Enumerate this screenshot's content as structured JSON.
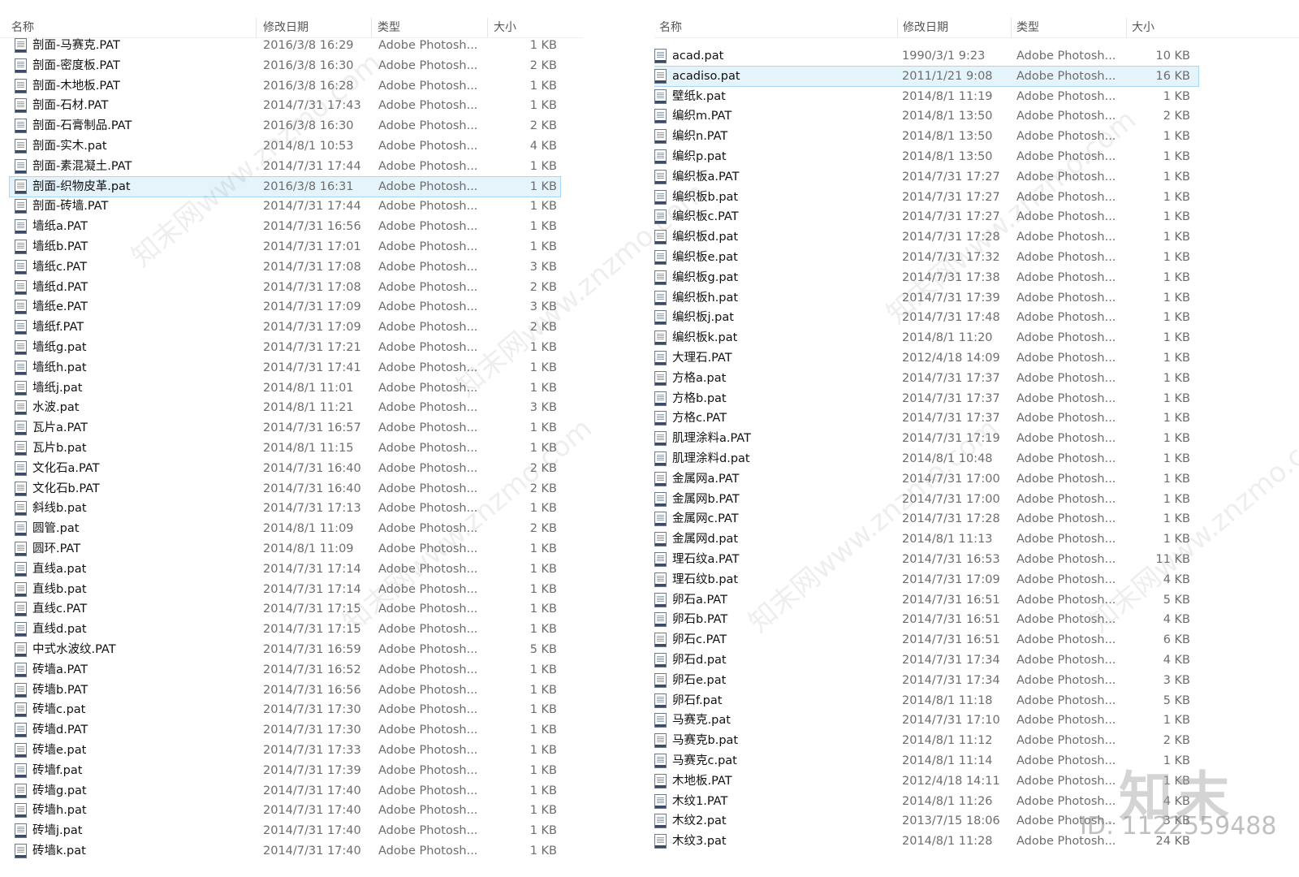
{
  "columns": {
    "name": "名称",
    "date": "修改日期",
    "type": "类型",
    "size": "大小"
  },
  "left_rows": [
    {
      "name": "剖面-马赛克.PAT",
      "date": "2016/3/8 16:29",
      "type": "Adobe Photosh...",
      "size": "1 KB"
    },
    {
      "name": "剖面-密度板.PAT",
      "date": "2016/3/8 16:30",
      "type": "Adobe Photosh...",
      "size": "2 KB"
    },
    {
      "name": "剖面-木地板.PAT",
      "date": "2016/3/8 16:28",
      "type": "Adobe Photosh...",
      "size": "1 KB"
    },
    {
      "name": "剖面-石材.PAT",
      "date": "2014/7/31 17:43",
      "type": "Adobe Photosh...",
      "size": "1 KB"
    },
    {
      "name": "剖面-石膏制品.PAT",
      "date": "2016/3/8 16:30",
      "type": "Adobe Photosh...",
      "size": "2 KB"
    },
    {
      "name": "剖面-实木.pat",
      "date": "2014/8/1 10:53",
      "type": "Adobe Photosh...",
      "size": "4 KB"
    },
    {
      "name": "剖面-素混凝土.PAT",
      "date": "2014/7/31 17:44",
      "type": "Adobe Photosh...",
      "size": "1 KB"
    },
    {
      "name": "剖面-织物皮革.pat",
      "date": "2016/3/8 16:31",
      "type": "Adobe Photosh...",
      "size": "1 KB",
      "selected": true
    },
    {
      "name": "剖面-砖墙.PAT",
      "date": "2014/7/31 17:44",
      "type": "Adobe Photosh...",
      "size": "1 KB"
    },
    {
      "name": "墙纸a.PAT",
      "date": "2014/7/31 16:56",
      "type": "Adobe Photosh...",
      "size": "1 KB"
    },
    {
      "name": "墙纸b.PAT",
      "date": "2014/7/31 17:01",
      "type": "Adobe Photosh...",
      "size": "1 KB"
    },
    {
      "name": "墙纸c.PAT",
      "date": "2014/7/31 17:08",
      "type": "Adobe Photosh...",
      "size": "3 KB"
    },
    {
      "name": "墙纸d.PAT",
      "date": "2014/7/31 17:08",
      "type": "Adobe Photosh...",
      "size": "2 KB"
    },
    {
      "name": "墙纸e.PAT",
      "date": "2014/7/31 17:09",
      "type": "Adobe Photosh...",
      "size": "3 KB"
    },
    {
      "name": "墙纸f.PAT",
      "date": "2014/7/31 17:09",
      "type": "Adobe Photosh...",
      "size": "2 KB"
    },
    {
      "name": "墙纸g.pat",
      "date": "2014/7/31 17:21",
      "type": "Adobe Photosh...",
      "size": "1 KB"
    },
    {
      "name": "墙纸h.pat",
      "date": "2014/7/31 17:41",
      "type": "Adobe Photosh...",
      "size": "1 KB"
    },
    {
      "name": "墙纸j.pat",
      "date": "2014/8/1 11:01",
      "type": "Adobe Photosh...",
      "size": "1 KB"
    },
    {
      "name": "水波.pat",
      "date": "2014/8/1 11:21",
      "type": "Adobe Photosh...",
      "size": "3 KB"
    },
    {
      "name": "瓦片a.PAT",
      "date": "2014/7/31 16:57",
      "type": "Adobe Photosh...",
      "size": "1 KB"
    },
    {
      "name": "瓦片b.pat",
      "date": "2014/8/1 11:15",
      "type": "Adobe Photosh...",
      "size": "1 KB"
    },
    {
      "name": "文化石a.PAT",
      "date": "2014/7/31 16:40",
      "type": "Adobe Photosh...",
      "size": "2 KB"
    },
    {
      "name": "文化石b.PAT",
      "date": "2014/7/31 16:40",
      "type": "Adobe Photosh...",
      "size": "2 KB"
    },
    {
      "name": "斜线b.pat",
      "date": "2014/7/31 17:13",
      "type": "Adobe Photosh...",
      "size": "1 KB"
    },
    {
      "name": "圆管.pat",
      "date": "2014/8/1 11:09",
      "type": "Adobe Photosh...",
      "size": "2 KB"
    },
    {
      "name": "圆环.PAT",
      "date": "2014/8/1 11:09",
      "type": "Adobe Photosh...",
      "size": "1 KB"
    },
    {
      "name": "直线a.pat",
      "date": "2014/7/31 17:14",
      "type": "Adobe Photosh...",
      "size": "1 KB"
    },
    {
      "name": "直线b.pat",
      "date": "2014/7/31 17:14",
      "type": "Adobe Photosh...",
      "size": "1 KB"
    },
    {
      "name": "直线c.PAT",
      "date": "2014/7/31 17:15",
      "type": "Adobe Photosh...",
      "size": "1 KB"
    },
    {
      "name": "直线d.pat",
      "date": "2014/7/31 17:15",
      "type": "Adobe Photosh...",
      "size": "1 KB"
    },
    {
      "name": "中式水波纹.PAT",
      "date": "2014/7/31 16:59",
      "type": "Adobe Photosh...",
      "size": "5 KB"
    },
    {
      "name": "砖墙a.PAT",
      "date": "2014/7/31 16:52",
      "type": "Adobe Photosh...",
      "size": "1 KB"
    },
    {
      "name": "砖墙b.PAT",
      "date": "2014/7/31 16:56",
      "type": "Adobe Photosh...",
      "size": "1 KB"
    },
    {
      "name": "砖墙c.pat",
      "date": "2014/7/31 17:30",
      "type": "Adobe Photosh...",
      "size": "1 KB"
    },
    {
      "name": "砖墙d.PAT",
      "date": "2014/7/31 17:30",
      "type": "Adobe Photosh...",
      "size": "1 KB"
    },
    {
      "name": "砖墙e.pat",
      "date": "2014/7/31 17:33",
      "type": "Adobe Photosh...",
      "size": "1 KB"
    },
    {
      "name": "砖墙f.pat",
      "date": "2014/7/31 17:39",
      "type": "Adobe Photosh...",
      "size": "1 KB"
    },
    {
      "name": "砖墙g.pat",
      "date": "2014/7/31 17:40",
      "type": "Adobe Photosh...",
      "size": "1 KB"
    },
    {
      "name": "砖墙h.pat",
      "date": "2014/7/31 17:40",
      "type": "Adobe Photosh...",
      "size": "1 KB"
    },
    {
      "name": "砖墙j.pat",
      "date": "2014/7/31 17:40",
      "type": "Adobe Photosh...",
      "size": "1 KB"
    },
    {
      "name": "砖墙k.pat",
      "date": "2014/7/31 17:40",
      "type": "Adobe Photosh...",
      "size": "1 KB"
    }
  ],
  "right_rows": [
    {
      "name": "acad.pat",
      "date": "1990/3/1 9:23",
      "type": "Adobe Photosh...",
      "size": "10 KB"
    },
    {
      "name": "acadiso.pat",
      "date": "2011/1/21 9:08",
      "type": "Adobe Photosh...",
      "size": "16 KB",
      "selected": true
    },
    {
      "name": "壁纸k.pat",
      "date": "2014/8/1 11:19",
      "type": "Adobe Photosh...",
      "size": "1 KB"
    },
    {
      "name": "编织m.PAT",
      "date": "2014/8/1 13:50",
      "type": "Adobe Photosh...",
      "size": "2 KB"
    },
    {
      "name": "编织n.PAT",
      "date": "2014/8/1 13:50",
      "type": "Adobe Photosh...",
      "size": "1 KB"
    },
    {
      "name": "编织p.pat",
      "date": "2014/8/1 13:50",
      "type": "Adobe Photosh...",
      "size": "1 KB"
    },
    {
      "name": "编织板a.PAT",
      "date": "2014/7/31 17:27",
      "type": "Adobe Photosh...",
      "size": "1 KB"
    },
    {
      "name": "编织板b.pat",
      "date": "2014/7/31 17:27",
      "type": "Adobe Photosh...",
      "size": "1 KB"
    },
    {
      "name": "编织板c.PAT",
      "date": "2014/7/31 17:27",
      "type": "Adobe Photosh...",
      "size": "1 KB"
    },
    {
      "name": "编织板d.pat",
      "date": "2014/7/31 17:28",
      "type": "Adobe Photosh...",
      "size": "1 KB"
    },
    {
      "name": "编织板e.pat",
      "date": "2014/7/31 17:32",
      "type": "Adobe Photosh...",
      "size": "1 KB"
    },
    {
      "name": "编织板g.pat",
      "date": "2014/7/31 17:38",
      "type": "Adobe Photosh...",
      "size": "1 KB"
    },
    {
      "name": "编织板h.pat",
      "date": "2014/7/31 17:39",
      "type": "Adobe Photosh...",
      "size": "1 KB"
    },
    {
      "name": "编织板j.pat",
      "date": "2014/7/31 17:48",
      "type": "Adobe Photosh...",
      "size": "1 KB"
    },
    {
      "name": "编织板k.pat",
      "date": "2014/8/1 11:20",
      "type": "Adobe Photosh...",
      "size": "1 KB"
    },
    {
      "name": "大理石.PAT",
      "date": "2012/4/18 14:09",
      "type": "Adobe Photosh...",
      "size": "1 KB"
    },
    {
      "name": "方格a.pat",
      "date": "2014/7/31 17:37",
      "type": "Adobe Photosh...",
      "size": "1 KB"
    },
    {
      "name": "方格b.pat",
      "date": "2014/7/31 17:37",
      "type": "Adobe Photosh...",
      "size": "1 KB"
    },
    {
      "name": "方格c.PAT",
      "date": "2014/7/31 17:37",
      "type": "Adobe Photosh...",
      "size": "1 KB"
    },
    {
      "name": "肌理涂料a.PAT",
      "date": "2014/7/31 17:19",
      "type": "Adobe Photosh...",
      "size": "1 KB"
    },
    {
      "name": "肌理涂料d.pat",
      "date": "2014/8/1 10:48",
      "type": "Adobe Photosh...",
      "size": "1 KB"
    },
    {
      "name": "金属网a.PAT",
      "date": "2014/7/31 17:00",
      "type": "Adobe Photosh...",
      "size": "1 KB"
    },
    {
      "name": "金属网b.PAT",
      "date": "2014/7/31 17:00",
      "type": "Adobe Photosh...",
      "size": "1 KB"
    },
    {
      "name": "金属网c.PAT",
      "date": "2014/7/31 17:28",
      "type": "Adobe Photosh...",
      "size": "1 KB"
    },
    {
      "name": "金属网d.pat",
      "date": "2014/8/1 11:13",
      "type": "Adobe Photosh...",
      "size": "1 KB"
    },
    {
      "name": "理石纹a.PAT",
      "date": "2014/7/31 16:53",
      "type": "Adobe Photosh...",
      "size": "11 KB"
    },
    {
      "name": "理石纹b.pat",
      "date": "2014/7/31 17:09",
      "type": "Adobe Photosh...",
      "size": "4 KB"
    },
    {
      "name": "卵石a.PAT",
      "date": "2014/7/31 16:51",
      "type": "Adobe Photosh...",
      "size": "5 KB"
    },
    {
      "name": "卵石b.PAT",
      "date": "2014/7/31 16:51",
      "type": "Adobe Photosh...",
      "size": "4 KB"
    },
    {
      "name": "卵石c.PAT",
      "date": "2014/7/31 16:51",
      "type": "Adobe Photosh...",
      "size": "6 KB"
    },
    {
      "name": "卵石d.pat",
      "date": "2014/7/31 17:34",
      "type": "Adobe Photosh...",
      "size": "4 KB"
    },
    {
      "name": "卵石e.pat",
      "date": "2014/7/31 17:34",
      "type": "Adobe Photosh...",
      "size": "3 KB"
    },
    {
      "name": "卵石f.pat",
      "date": "2014/8/1 11:18",
      "type": "Adobe Photosh...",
      "size": "5 KB"
    },
    {
      "name": "马赛克.pat",
      "date": "2014/7/31 17:10",
      "type": "Adobe Photosh...",
      "size": "1 KB"
    },
    {
      "name": "马赛克b.pat",
      "date": "2014/8/1 11:12",
      "type": "Adobe Photosh...",
      "size": "2 KB"
    },
    {
      "name": "马赛克c.pat",
      "date": "2014/8/1 11:14",
      "type": "Adobe Photosh...",
      "size": "1 KB"
    },
    {
      "name": "木地板.PAT",
      "date": "2012/4/18 14:11",
      "type": "Adobe Photosh...",
      "size": "1 KB"
    },
    {
      "name": "木纹1.PAT",
      "date": "2014/8/1 11:26",
      "type": "Adobe Photosh...",
      "size": "4 KB"
    },
    {
      "name": "木纹2.pat",
      "date": "2013/7/15 18:06",
      "type": "Adobe Photosh...",
      "size": "3 KB"
    },
    {
      "name": "木纹3.pat",
      "date": "2014/8/1 11:28",
      "type": "Adobe Photosh...",
      "size": "24 KB"
    }
  ],
  "watermark": {
    "text": "知末网www.znzmo.com",
    "logo": "知末",
    "id": "ID: 1122559488"
  },
  "colors": {
    "selected_bg": "#e5f3fb",
    "selected_border": "#a9d6f5",
    "icon_band": "#3b4a66"
  }
}
